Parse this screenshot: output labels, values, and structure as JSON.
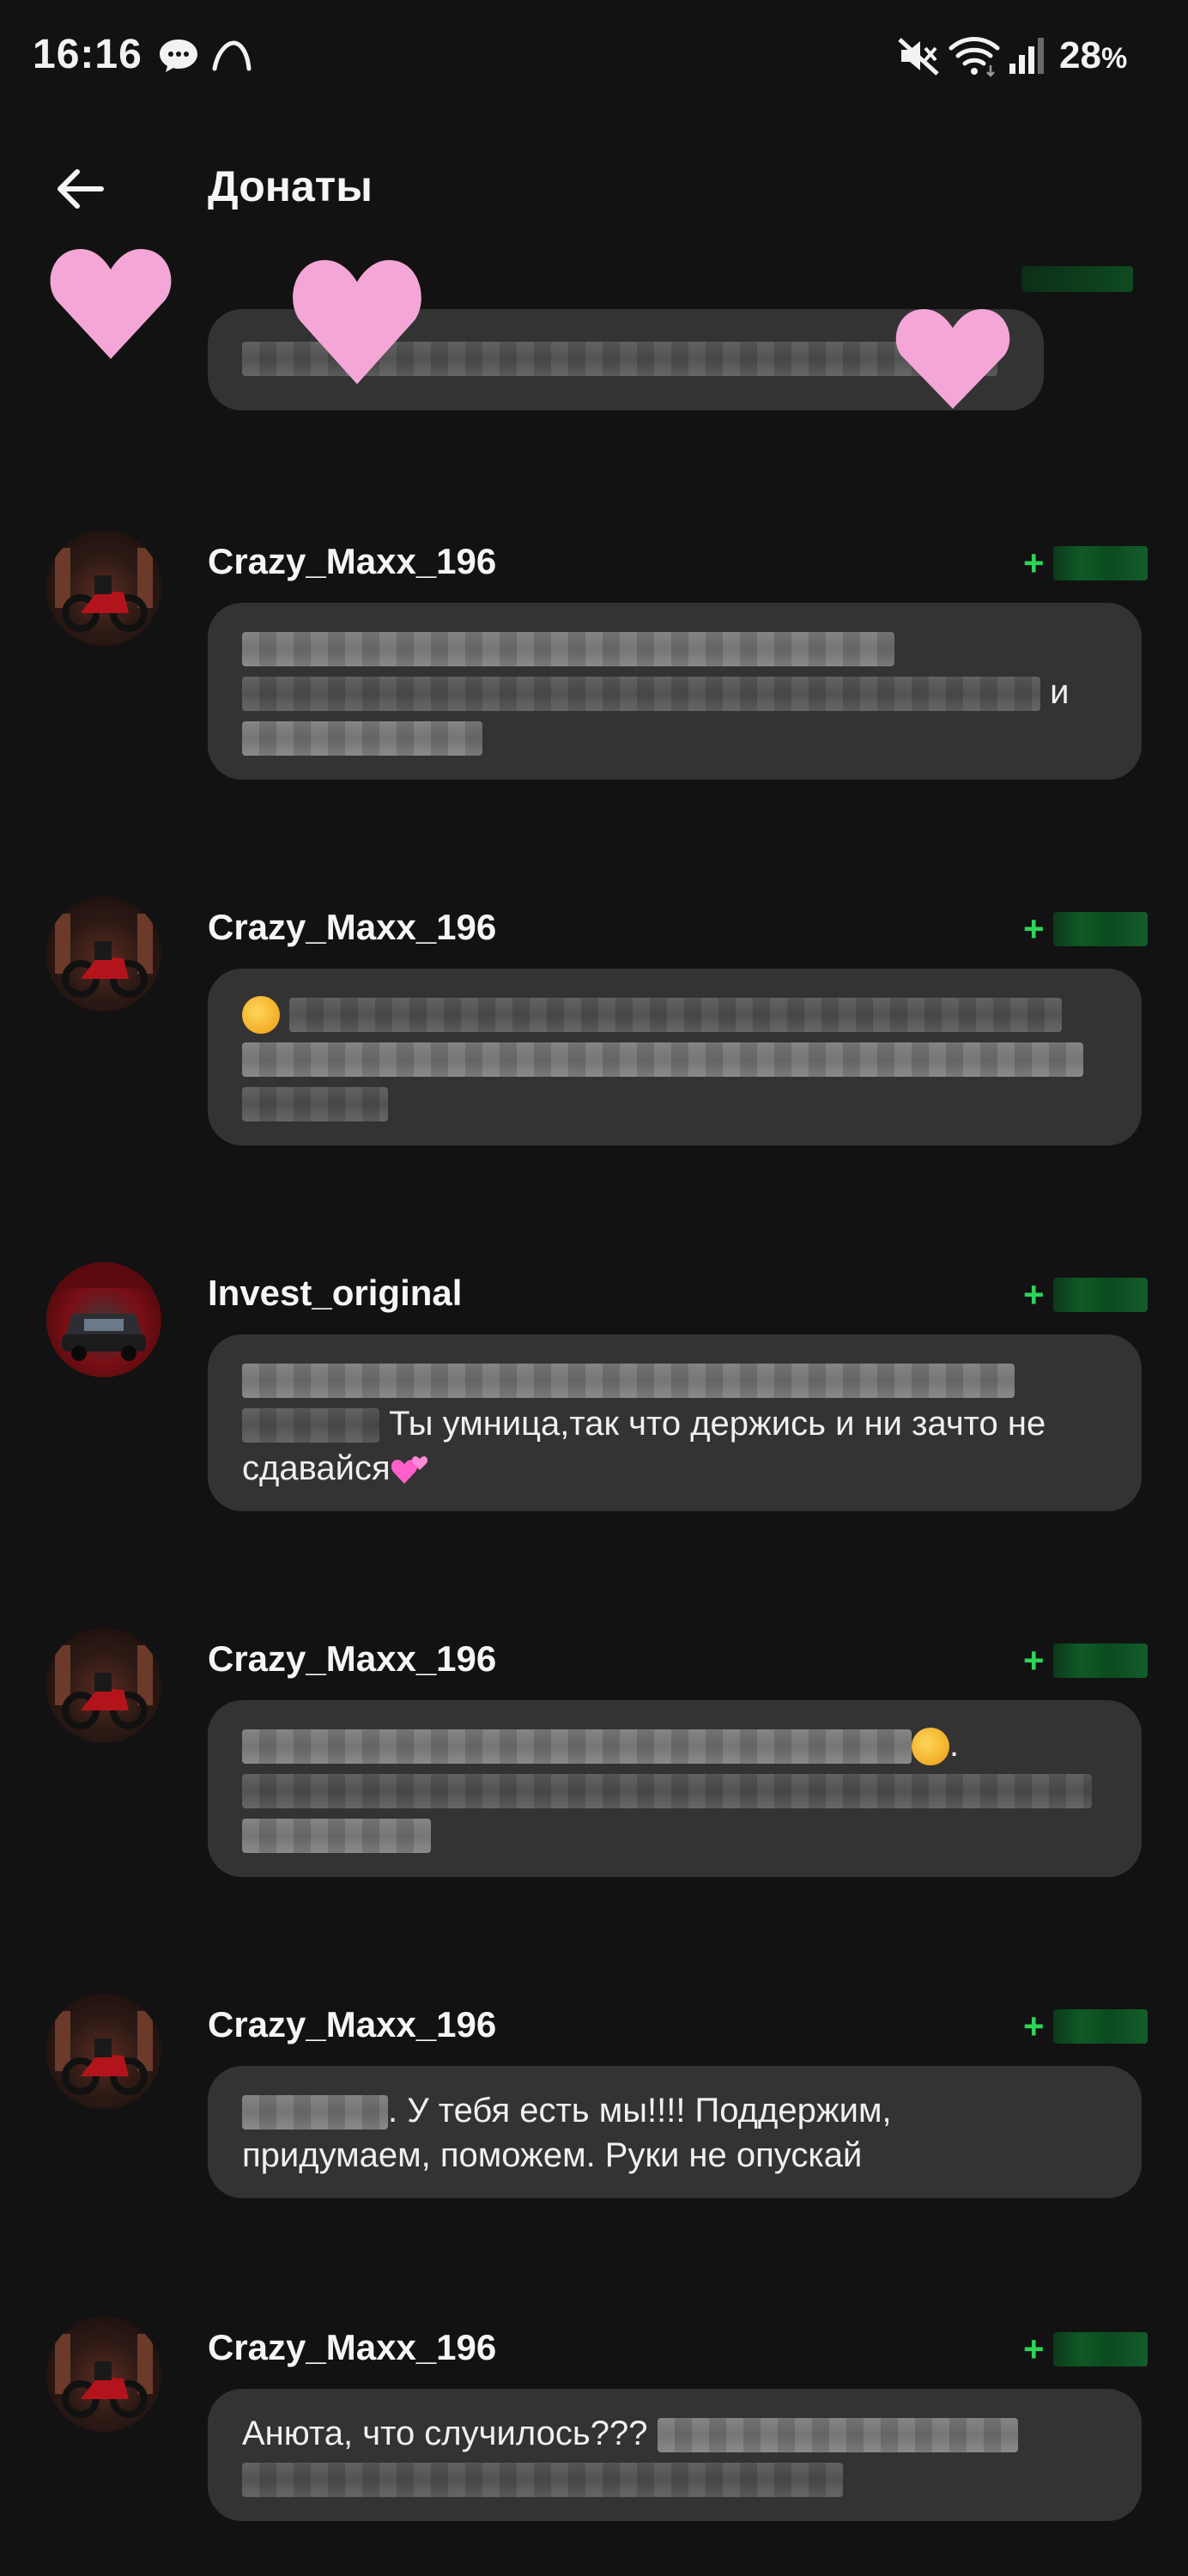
{
  "status_bar": {
    "time": "16:16",
    "battery": "28",
    "battery_unit": "%",
    "icons": [
      "chat-bubble-icon",
      "arc-icon",
      "mute-icon",
      "wifi-icon",
      "signal-icon"
    ]
  },
  "header": {
    "title": "Донаты",
    "back_icon": "arrow-left-icon"
  },
  "colors": {
    "background": "#121212",
    "bubble": "#333333",
    "amount": "#2fd35a",
    "text": "#f2f2f2"
  },
  "donations": [
    {
      "username": "Crazy_Maxx_196",
      "amount_prefix": "+",
      "text_lines": [],
      "partial_text": "и"
    },
    {
      "username": "Crazy_Maxx_196",
      "amount_prefix": "+",
      "text_lines": []
    },
    {
      "username": "Invest_original",
      "amount_prefix": "+",
      "text_line_1": "Ты умница,так что держись и ни зачто не",
      "text_line_2": "сдавайся"
    },
    {
      "username": "Crazy_Maxx_196",
      "amount_prefix": "+",
      "trailing": "."
    },
    {
      "username": "Crazy_Maxx_196",
      "amount_prefix": "+",
      "text_line_1": ". У тебя есть мы!!!! Поддержим,",
      "text_line_2": "придумаем, поможем. Руки не опускай"
    },
    {
      "username": "Crazy_Maxx_196",
      "amount_prefix": "+",
      "text_line_1": "Анюта, что случилось???"
    }
  ]
}
